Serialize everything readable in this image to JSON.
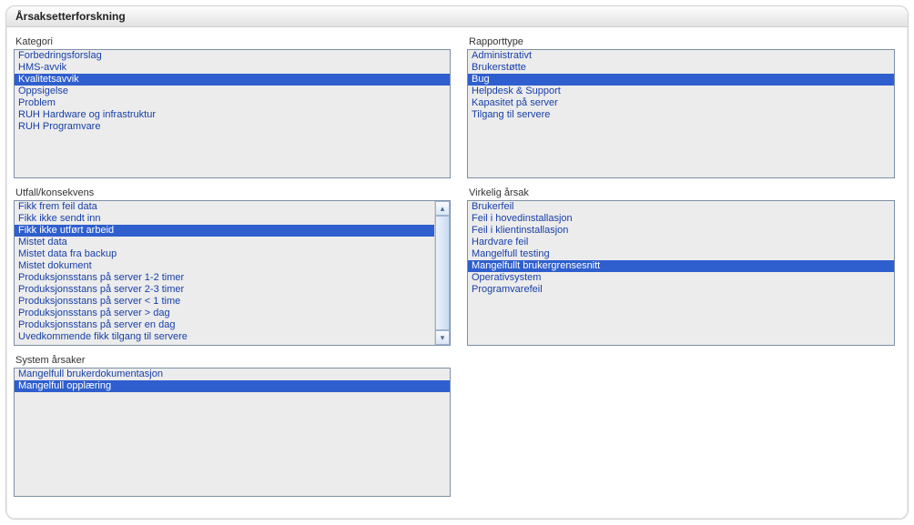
{
  "title": "Årsaksetterforskning",
  "kategori": {
    "label": "Kategori",
    "items": [
      {
        "label": "Forbedringsforslag",
        "selected": false
      },
      {
        "label": "HMS-avvik",
        "selected": false
      },
      {
        "label": "Kvalitetsavvik",
        "selected": true
      },
      {
        "label": "Oppsigelse",
        "selected": false
      },
      {
        "label": "Problem",
        "selected": false
      },
      {
        "label": "RUH Hardware og infrastruktur",
        "selected": false
      },
      {
        "label": "RUH Programvare",
        "selected": false
      }
    ]
  },
  "rapporttype": {
    "label": "Rapporttype",
    "items": [
      {
        "label": "Administrativt",
        "selected": false
      },
      {
        "label": "Brukerstøtte",
        "selected": false
      },
      {
        "label": "Bug",
        "selected": true
      },
      {
        "label": "Helpdesk & Support",
        "selected": false
      },
      {
        "label": "Kapasitet på server",
        "selected": false
      },
      {
        "label": "Tilgang til servere",
        "selected": false
      }
    ]
  },
  "utfall": {
    "label": "Utfall/konsekvens",
    "items": [
      {
        "label": "Fikk frem feil data",
        "selected": false
      },
      {
        "label": "Fikk ikke sendt inn",
        "selected": false
      },
      {
        "label": "Fikk ikke utført arbeid",
        "selected": true
      },
      {
        "label": "Mistet data",
        "selected": false
      },
      {
        "label": "Mistet data fra backup",
        "selected": false
      },
      {
        "label": "Mistet dokument",
        "selected": false
      },
      {
        "label": "Produksjonsstans på server 1-2 timer",
        "selected": false
      },
      {
        "label": "Produksjonsstans på server 2-3 timer",
        "selected": false
      },
      {
        "label": "Produksjonsstans på server < 1 time",
        "selected": false
      },
      {
        "label": "Produksjonsstans på server > dag",
        "selected": false
      },
      {
        "label": "Produksjonsstans på server en dag",
        "selected": false
      },
      {
        "label": "Uvedkommende fikk tilgang til servere",
        "selected": false
      }
    ]
  },
  "virkelig": {
    "label": "Virkelig årsak",
    "items": [
      {
        "label": "Brukerfeil",
        "selected": false
      },
      {
        "label": "Feil i hovedinstallasjon",
        "selected": false
      },
      {
        "label": "Feil i klientinstallasjon",
        "selected": false
      },
      {
        "label": "Hardvare feil",
        "selected": false
      },
      {
        "label": "Mangelfull testing",
        "selected": false
      },
      {
        "label": "Mangelfullt brukergrensesnitt",
        "selected": true
      },
      {
        "label": "Operativsystem",
        "selected": false
      },
      {
        "label": "Programvarefeil",
        "selected": false
      }
    ]
  },
  "system": {
    "label": "System årsaker",
    "items": [
      {
        "label": "Mangelfull brukerdokumentasjon",
        "selected": false
      },
      {
        "label": "Mangelfull opplæring",
        "selected": true
      }
    ]
  }
}
